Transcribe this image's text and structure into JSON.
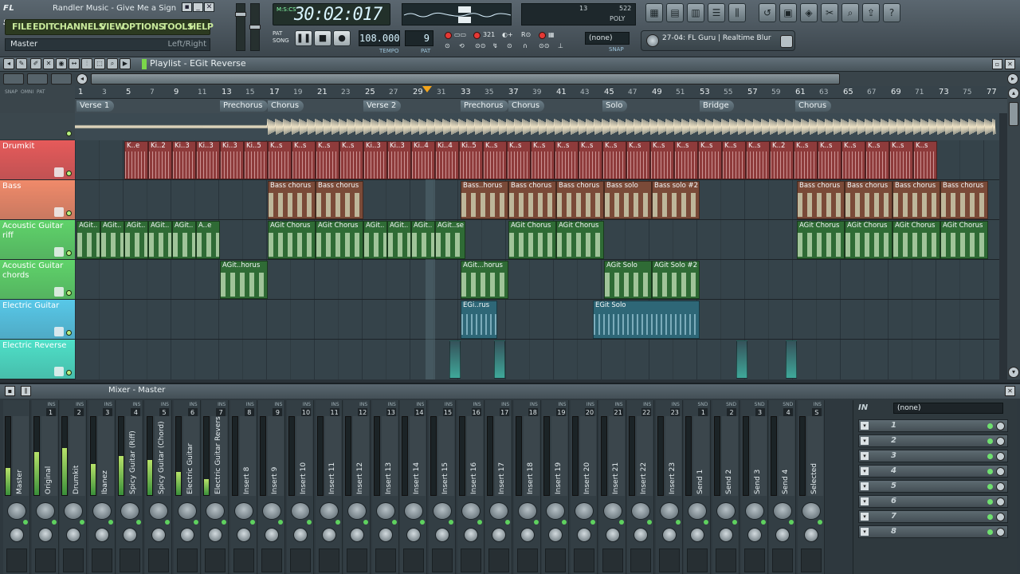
{
  "app": {
    "logo": "FL STUDIO",
    "song_title": "Randler Music - Give Me a Sign",
    "menu": [
      "FILE",
      "EDIT",
      "CHANNELS",
      "VIEW",
      "OPTIONS",
      "TOOLS",
      "HELP"
    ],
    "hint_left": "Master",
    "hint_right": "Left/Right",
    "time": "30:02:017",
    "time_unit": "M:S:CS",
    "tempo": "108.000",
    "tempo_label": "TEMPO",
    "pattern": "9",
    "pattern_label": "PAT",
    "snap": "(none)",
    "snap_label": "SNAP",
    "pat_song": [
      "PAT",
      "SONG"
    ],
    "cpu": "13",
    "mem": "522",
    "poly_label": "POLY",
    "browser_hint": "27-04: FL Guru | Realtime Blur"
  },
  "playlist": {
    "title": "Playlist - EGit Reverse",
    "left_top_labels": [
      "SNAP",
      "OMNI",
      "PAT"
    ],
    "bar_numbers": [
      "1",
      "3",
      "5",
      "7",
      "9",
      "11",
      "13",
      "15",
      "17",
      "19",
      "21",
      "23",
      "25",
      "27",
      "29",
      "31",
      "33",
      "35",
      "37",
      "39",
      "41",
      "43",
      "45",
      "47",
      "49",
      "51",
      "53",
      "55",
      "57",
      "59",
      "61",
      "63",
      "65",
      "67",
      "69",
      "71",
      "73",
      "75",
      "77"
    ],
    "markers": [
      {
        "label": "Verse 1"
      },
      {
        "label": "Prechorus"
      },
      {
        "label": "Chorus"
      },
      {
        "label": "Verse 2"
      },
      {
        "label": "Prechorus"
      },
      {
        "label": "Chorus"
      },
      {
        "label": "Solo"
      },
      {
        "label": "Bridge"
      },
      {
        "label": "Chorus"
      }
    ],
    "tracks": [
      {
        "name": "Drumkit",
        "color": "#e65a5a"
      },
      {
        "name": "Bass",
        "color": "#f08a6a"
      },
      {
        "name": "Acoustic Guitar riff",
        "color": "#5fd36a"
      },
      {
        "name": "Acoustic Guitar chords",
        "color": "#5fd36a"
      },
      {
        "name": "Electric Guitar",
        "color": "#58c8e8"
      },
      {
        "name": "Electric Reverse",
        "color": "#4ee0c8"
      }
    ],
    "clip_labels": {
      "drum": [
        "K..e",
        "Ki..2",
        "Ki..3",
        "Ki..3",
        "Ki..3",
        "Ki..5",
        "K..s",
        "K..s",
        "K..s",
        "K..s",
        "Ki..3",
        "Ki..3",
        "Ki..4",
        "Ki..4",
        "Ki..5",
        "K..s",
        "K..s",
        "K..s",
        "K..s",
        "K..s",
        "K..s",
        "K..s",
        "K..s",
        "K..s",
        "K..s",
        "K..s",
        "K..s",
        "K..2",
        "K..s",
        "K..s",
        "K..s",
        "K..s",
        "K..s",
        "K..s"
      ],
      "bass": [
        "Bass chorus",
        "Bass chorus",
        "Bass..horus",
        "Bass chorus",
        "Bass chorus",
        "Bass solo",
        "Bass solo #2",
        "Bass chorus",
        "Bass chorus",
        "Bass chorus",
        "Bass chorus"
      ],
      "agit_riff": [
        "AGit..",
        "AGit..",
        "AGit..",
        "AGit..",
        "AGit..",
        "A..e",
        "AGit Chorus",
        "AGit Chorus",
        "AGit..",
        "AGit..",
        "AGit..",
        "AGit..se",
        "AGit Chorus",
        "AGit Chorus",
        "AGit Chorus",
        "AGit Chorus",
        "AGit Chorus",
        "AGit Chorus"
      ],
      "agit_chords": [
        "AGit..horus",
        "AGit...horus",
        "AGit Solo",
        "AGit Solo #2"
      ],
      "egit": [
        "EGi..rus",
        "EGit Solo"
      ]
    }
  },
  "mixer": {
    "title": "Mixer - Master",
    "fx_in_label": "IN",
    "fx_select": "(none)",
    "fx_slots": [
      "1",
      "2",
      "3",
      "4",
      "5",
      "6",
      "7",
      "8"
    ],
    "ins_label": "INS",
    "snd_label": "SND",
    "strips": [
      {
        "label": "Master",
        "num": "",
        "meter": 0.35
      },
      {
        "label": "Original",
        "num": "1",
        "meter": 0.55
      },
      {
        "label": "Drumkit",
        "num": "2",
        "meter": 0.6
      },
      {
        "label": "Ibanez",
        "num": "3",
        "meter": 0.4
      },
      {
        "label": "Spicy Guitar (Riff)",
        "num": "4",
        "meter": 0.5
      },
      {
        "label": "Spicy Guitar (Chord)",
        "num": "5",
        "meter": 0.45
      },
      {
        "label": "Electric Guitar",
        "num": "6",
        "meter": 0.3
      },
      {
        "label": "Electric Guitar Revers",
        "num": "7",
        "meter": 0.2
      },
      {
        "label": "Insert 8",
        "num": "8",
        "meter": 0
      },
      {
        "label": "Insert 9",
        "num": "9",
        "meter": 0
      },
      {
        "label": "Insert 10",
        "num": "10",
        "meter": 0
      },
      {
        "label": "Insert 11",
        "num": "11",
        "meter": 0
      },
      {
        "label": "Insert 12",
        "num": "12",
        "meter": 0
      },
      {
        "label": "Insert 13",
        "num": "13",
        "meter": 0
      },
      {
        "label": "Insert 14",
        "num": "14",
        "meter": 0
      },
      {
        "label": "Insert 15",
        "num": "15",
        "meter": 0
      },
      {
        "label": "Insert 16",
        "num": "16",
        "meter": 0
      },
      {
        "label": "Insert 17",
        "num": "17",
        "meter": 0
      },
      {
        "label": "Insert 18",
        "num": "18",
        "meter": 0
      },
      {
        "label": "Insert 19",
        "num": "19",
        "meter": 0
      },
      {
        "label": "Insert 20",
        "num": "20",
        "meter": 0
      },
      {
        "label": "Insert 21",
        "num": "21",
        "meter": 0
      },
      {
        "label": "Insert 22",
        "num": "22",
        "meter": 0
      },
      {
        "label": "Insert 23",
        "num": "23",
        "meter": 0
      },
      {
        "label": "Send 1",
        "num": "1",
        "meter": 0
      },
      {
        "label": "Send 2",
        "num": "2",
        "meter": 0
      },
      {
        "label": "Send 3",
        "num": "3",
        "meter": 0
      },
      {
        "label": "Send 4",
        "num": "4",
        "meter": 0
      },
      {
        "label": "Selected",
        "num": "S",
        "meter": 0
      }
    ]
  },
  "icons": {
    "toolbar": [
      "playlist-icon",
      "step-sequencer-icon",
      "piano-roll-icon",
      "browser-icon",
      "mixer-icon",
      "undo-icon",
      "save-icon",
      "render-icon",
      "cut-icon",
      "zoom-icon",
      "export-icon",
      "help-icon"
    ]
  }
}
